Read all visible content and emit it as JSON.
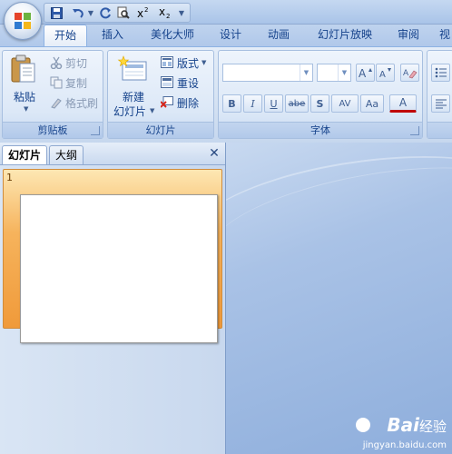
{
  "tabs": [
    {
      "label": "开始",
      "active": true
    },
    {
      "label": "插入"
    },
    {
      "label": "美化大师"
    },
    {
      "label": "设计"
    },
    {
      "label": "动画"
    },
    {
      "label": "幻灯片放映"
    },
    {
      "label": "审阅"
    },
    {
      "label": "视"
    }
  ],
  "ribbon": {
    "clipboard": {
      "group_label": "剪贴板",
      "paste_label": "粘贴",
      "cut_label": "剪切",
      "copy_label": "复制",
      "format_painter_label": "格式刷"
    },
    "slides": {
      "group_label": "幻灯片",
      "new_slide_line1": "新建",
      "new_slide_line2": "幻灯片",
      "layout_label": "版式",
      "reset_label": "重设",
      "delete_label": "删除"
    },
    "font": {
      "group_label": "字体",
      "font_name_value": "",
      "font_size_value": "",
      "bold_label": "B",
      "italic_label": "I",
      "underline_label": "U",
      "strike_label": "abe",
      "shadow_label": "S",
      "spacing_label": "AV",
      "case_label": "Aa",
      "color_label": "A"
    }
  },
  "panel": {
    "tab_slides": "幻灯片",
    "tab_outline": "大纲",
    "close_glyph": "✕",
    "slide_number": "1"
  },
  "watermark": {
    "brand": "Bai",
    "brand_text": "经验",
    "url": "jingyan.baidu.com"
  },
  "colors": {
    "accent": "#15428b",
    "selected_slide": "#f6b35c",
    "ribbon": "#d6e3f3"
  }
}
